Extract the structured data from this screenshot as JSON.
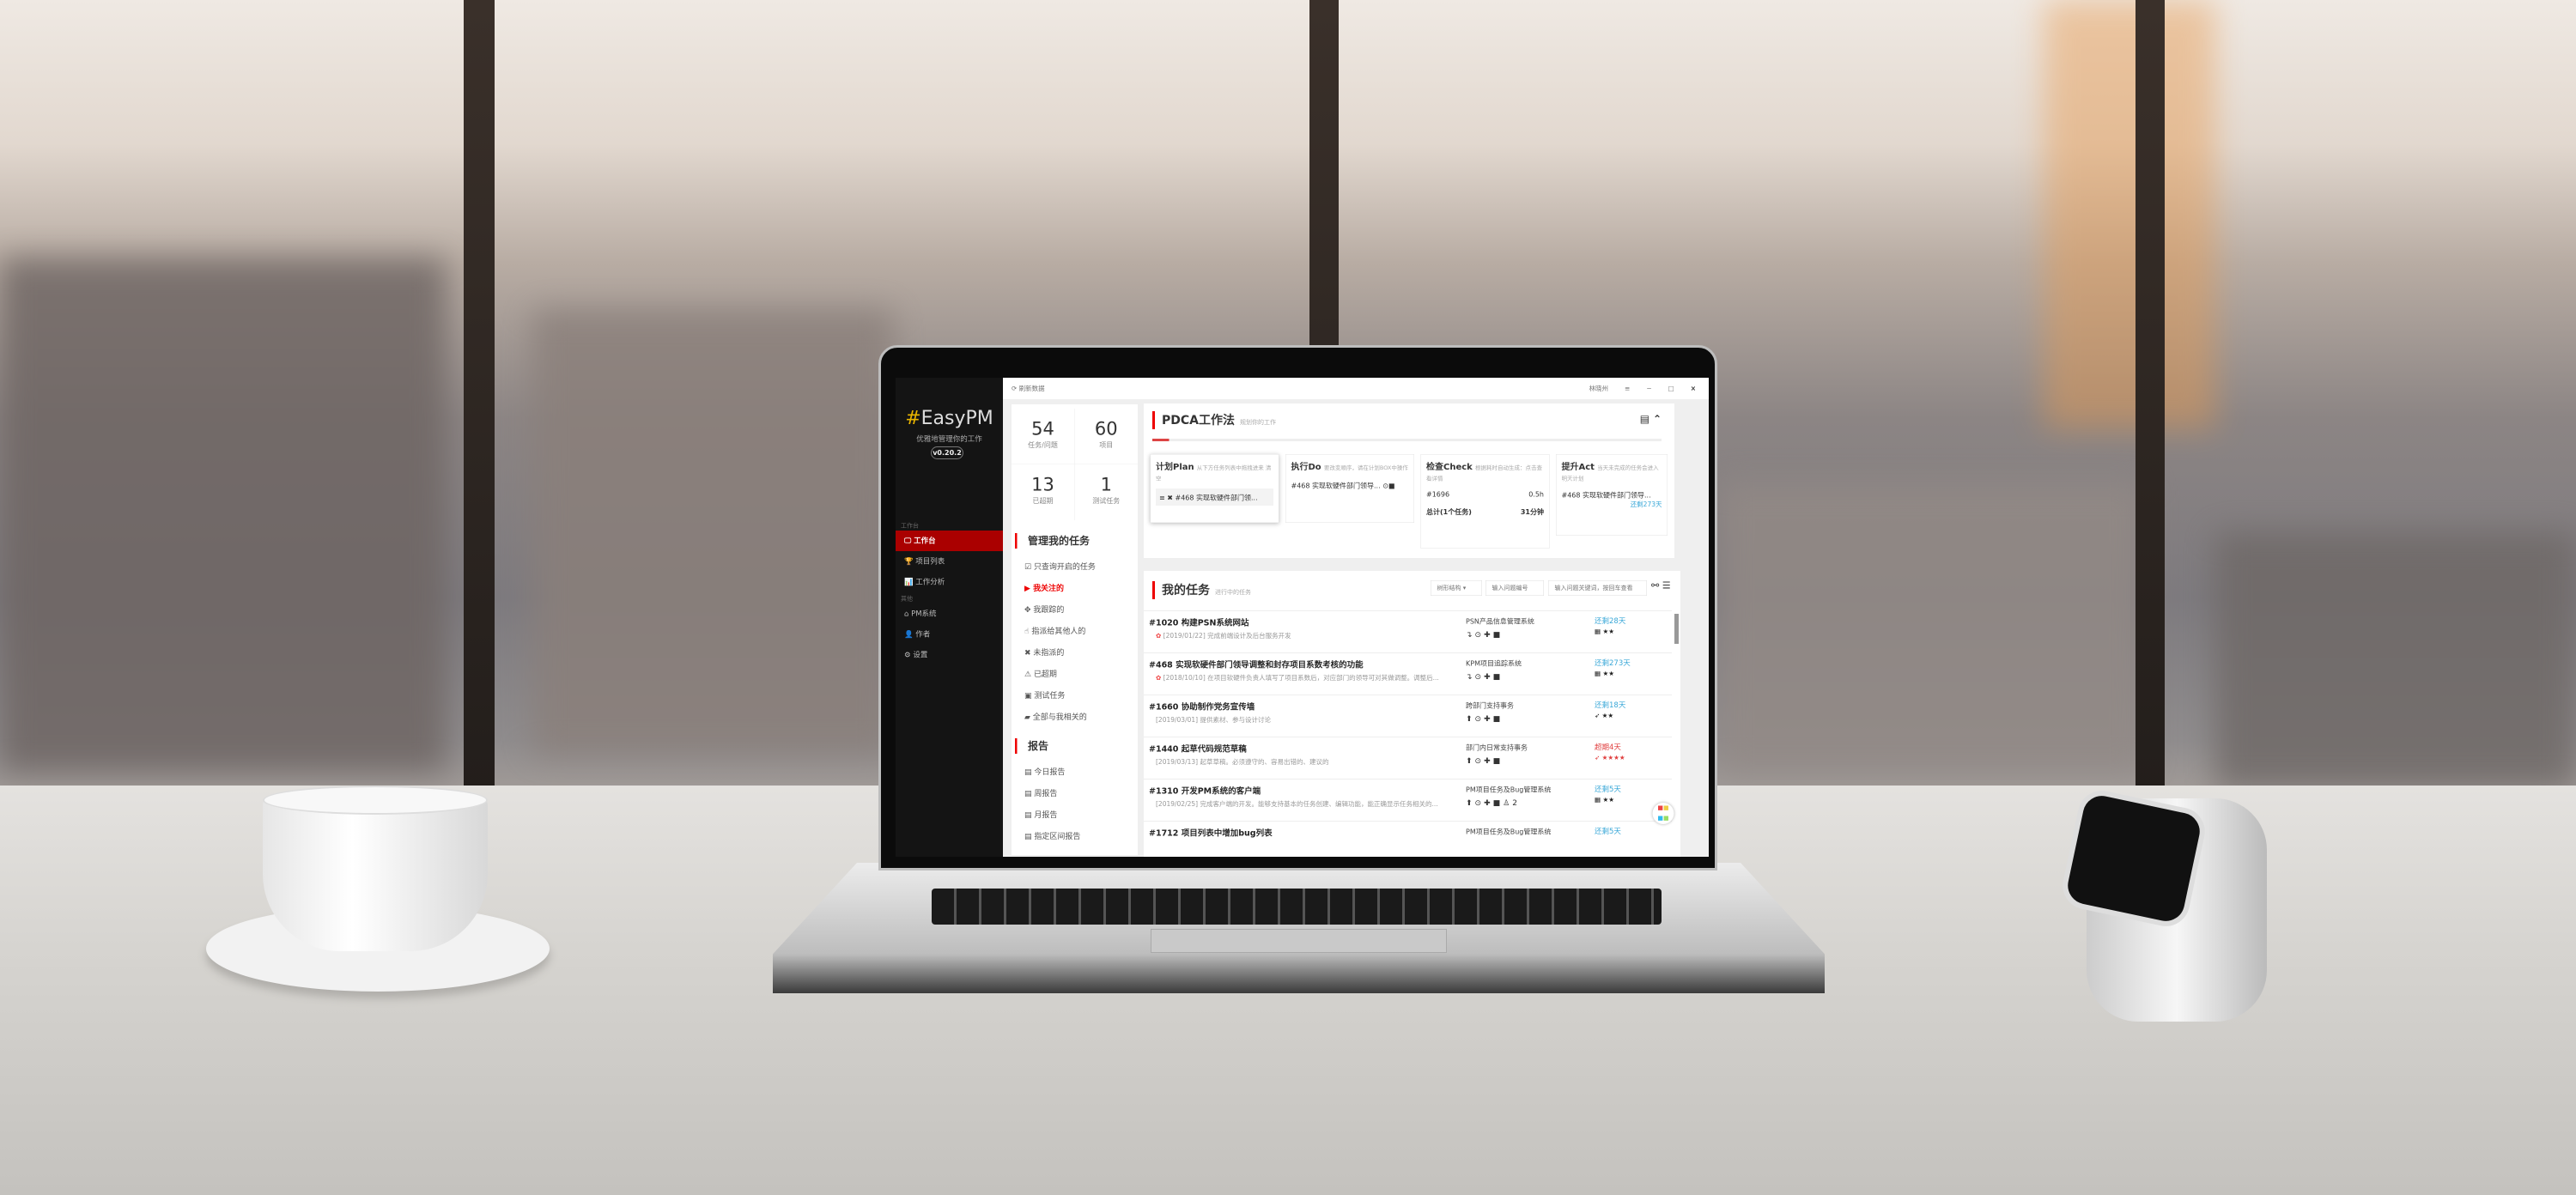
{
  "window": {
    "refresh": "⟳ 刷新数据",
    "user": "林晓州",
    "menu_icon": "≡",
    "min": "−",
    "max": "□",
    "close": "×"
  },
  "sidebar": {
    "logo_hash": "#",
    "logo": "EasyPM",
    "slogan": "优雅地管理你的工作",
    "version": "v0.20.2",
    "groups": [
      {
        "header": "工作台",
        "items": [
          {
            "icon": "🖵",
            "label": "工作台"
          },
          {
            "icon": "🏆",
            "label": "项目列表"
          },
          {
            "icon": "📊",
            "label": "工作分析"
          }
        ]
      },
      {
        "header": "其他",
        "items": [
          {
            "icon": "⌂",
            "label": "PM系统"
          },
          {
            "icon": "👤",
            "label": "作者"
          },
          {
            "icon": "⚙",
            "label": "设置"
          }
        ]
      }
    ]
  },
  "stats": [
    {
      "value": "54",
      "label": "任务/问题"
    },
    {
      "value": "60",
      "label": "项目"
    },
    {
      "value": "13",
      "label": "已超期"
    },
    {
      "value": "1",
      "label": "测试任务"
    }
  ],
  "manage": {
    "title": "管理我的任务",
    "items": [
      {
        "icon": "☑",
        "label": "只查询开启的任务"
      },
      {
        "icon": "▶",
        "label": "我关注的"
      },
      {
        "icon": "✥",
        "label": "我跟踪的"
      },
      {
        "icon": "☝",
        "label": "指派给其他人的"
      },
      {
        "icon": "✖",
        "label": "未指派的"
      },
      {
        "icon": "⚠",
        "label": "已超期"
      },
      {
        "icon": "▣",
        "label": "测试任务"
      },
      {
        "icon": "▰",
        "label": "全部与我相关的"
      }
    ]
  },
  "report": {
    "title": "报告",
    "items": [
      {
        "label": "今日报告"
      },
      {
        "label": "周报告"
      },
      {
        "label": "月报告"
      },
      {
        "label": "指定区间报告"
      }
    ]
  },
  "pdca": {
    "title": "PDCA工作法",
    "subtitle": "规划你的工作",
    "plan": {
      "title": "计划Plan",
      "hint": "从下方任务列表中拖拽进来 清空",
      "item": "#468 实现软硬件部门领..."
    },
    "do": {
      "title": "执行Do",
      "hint": "要改变顺序，请在计划BOX中操作",
      "item": "#468 实现软硬件部门领导..."
    },
    "check": {
      "title": "检查Check",
      "hint": "根据耗时自动生成：点击查看详情",
      "item": "#1696",
      "hours": "0.5h",
      "total_label": "总计(1个任务)",
      "total": "31分钟"
    },
    "act": {
      "title": "提升Act",
      "hint": "当天未完成的任务会进入明天计划",
      "item": "#468 实现软硬件部门领导...",
      "due": "还剩273天"
    }
  },
  "tasks": {
    "title": "我的任务",
    "subtitle": "进行中的任务",
    "view_select": "树形结构",
    "id_placeholder": "输入问题编号",
    "kw_placeholder": "输入问题关键词，按回车查看",
    "rows": [
      {
        "title": "#1020 构建PSN系统网站",
        "desc": "[2019/01/22] 完成前端设计及后台服务开发",
        "project": "PSN产品信息管理系统",
        "due": "还剩28天",
        "overdue": false,
        "priority": "▦ ★★"
      },
      {
        "title": "#468 实现软硬件部门领导调整和封存项目系数考核的功能",
        "desc": "[2018/10/10] 在项目软硬件负责人填写了项目系数后，对应部门的领导可对其做调整。调整后...",
        "project": "KPM项目追踪系统",
        "due": "还剩273天",
        "overdue": false,
        "priority": "▦ ★★"
      },
      {
        "title": "#1660 协助制作党务宣传墙",
        "desc": "[2019/03/01] 提供素材、参与设计讨论",
        "project": "跨部门支持事务",
        "due": "还剩18天",
        "overdue": false,
        "priority": "➶ ★★"
      },
      {
        "title": "#1440 起草代码规范草稿",
        "desc": "[2019/03/13] 起草草稿。必须遵守的、容易出错的、建议的",
        "project": "部门内日常支持事务",
        "due": "超期4天",
        "overdue": true,
        "priority": "➶ ★★★★"
      },
      {
        "title": "#1310 开发PM系统的客户端",
        "desc": "[2019/02/25] 完成客户端的开发。能够支持基本的任务创建、编辑功能，能正确显示任务相关的...",
        "project": "PM项目任务及Bug管理系统",
        "due": "还剩5天",
        "overdue": false,
        "priority": "▦ ★★",
        "extra": "2"
      },
      {
        "title": "#1712 项目列表中增加bug列表",
        "desc": "",
        "project": "PM项目任务及Bug管理系统",
        "due": "还剩5天",
        "overdue": false,
        "priority": ""
      }
    ]
  },
  "colors": {
    "accent": "#e00000",
    "sidebar": "#141414",
    "active": "#aa0000",
    "link": "#3aa8d8",
    "overdue": "#e04040"
  }
}
